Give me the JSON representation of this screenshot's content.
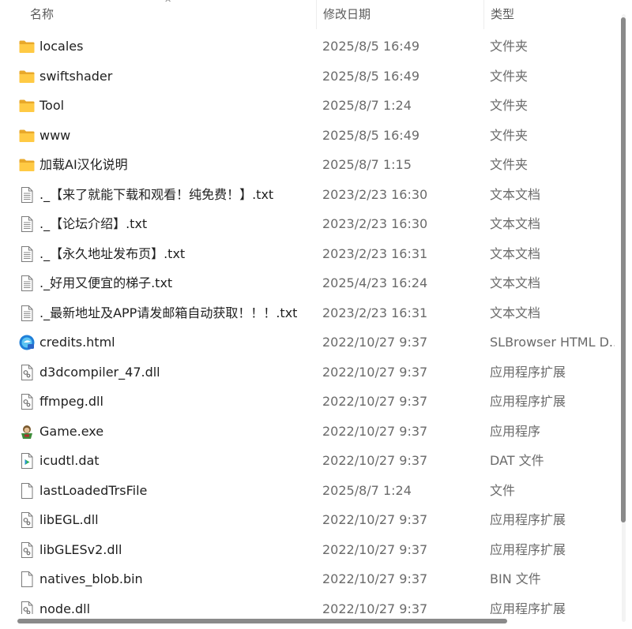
{
  "columns": {
    "name": "名称",
    "date": "修改日期",
    "type": "类型",
    "sort_indicator": "^"
  },
  "files": [
    {
      "name": "locales",
      "date": "2025/8/5 16:49",
      "type": "文件夹",
      "icon": "folder-icon"
    },
    {
      "name": "swiftshader",
      "date": "2025/8/5 16:49",
      "type": "文件夹",
      "icon": "folder-icon"
    },
    {
      "name": "Tool",
      "date": "2025/8/7 1:24",
      "type": "文件夹",
      "icon": "folder-icon"
    },
    {
      "name": "www",
      "date": "2025/8/5 16:49",
      "type": "文件夹",
      "icon": "folder-icon"
    },
    {
      "name": "加载AI汉化说明",
      "date": "2025/8/7 1:15",
      "type": "文件夹",
      "icon": "folder-icon"
    },
    {
      "name": "._【来了就能下载和观看！纯免费！】.txt",
      "date": "2023/2/23 16:30",
      "type": "文本文档",
      "icon": "text-document-icon"
    },
    {
      "name": "._【论坛介绍】.txt",
      "date": "2023/2/23 16:30",
      "type": "文本文档",
      "icon": "text-document-icon"
    },
    {
      "name": "._【永久地址发布页】.txt",
      "date": "2023/2/23 16:31",
      "type": "文本文档",
      "icon": "text-document-icon"
    },
    {
      "name": "._好用又便宜的梯子.txt",
      "date": "2025/4/23 16:24",
      "type": "文本文档",
      "icon": "text-document-icon"
    },
    {
      "name": "._最新地址及APP请发邮箱自动获取！！！.txt",
      "date": "2023/2/23 16:31",
      "type": "文本文档",
      "icon": "text-document-icon"
    },
    {
      "name": "credits.html",
      "date": "2022/10/27 9:37",
      "type": "SLBrowser HTML D...",
      "icon": "browser-icon"
    },
    {
      "name": "d3dcompiler_47.dll",
      "date": "2022/10/27 9:37",
      "type": "应用程序扩展",
      "icon": "dll-icon"
    },
    {
      "name": "ffmpeg.dll",
      "date": "2022/10/27 9:37",
      "type": "应用程序扩展",
      "icon": "dll-icon"
    },
    {
      "name": "Game.exe",
      "date": "2022/10/27 9:37",
      "type": "应用程序",
      "icon": "game-app-icon"
    },
    {
      "name": "icudtl.dat",
      "date": "2022/10/27 9:37",
      "type": "DAT 文件",
      "icon": "media-file-icon"
    },
    {
      "name": "lastLoadedTrsFile",
      "date": "2025/8/7 1:24",
      "type": "文件",
      "icon": "blank-file-icon"
    },
    {
      "name": "libEGL.dll",
      "date": "2022/10/27 9:37",
      "type": "应用程序扩展",
      "icon": "dll-icon"
    },
    {
      "name": "libGLESv2.dll",
      "date": "2022/10/27 9:37",
      "type": "应用程序扩展",
      "icon": "dll-icon"
    },
    {
      "name": "natives_blob.bin",
      "date": "2022/10/27 9:37",
      "type": "BIN 文件",
      "icon": "blank-file-icon"
    },
    {
      "name": "node.dll",
      "date": "2022/10/27 9:37",
      "type": "应用程序扩展",
      "icon": "dll-icon"
    }
  ]
}
